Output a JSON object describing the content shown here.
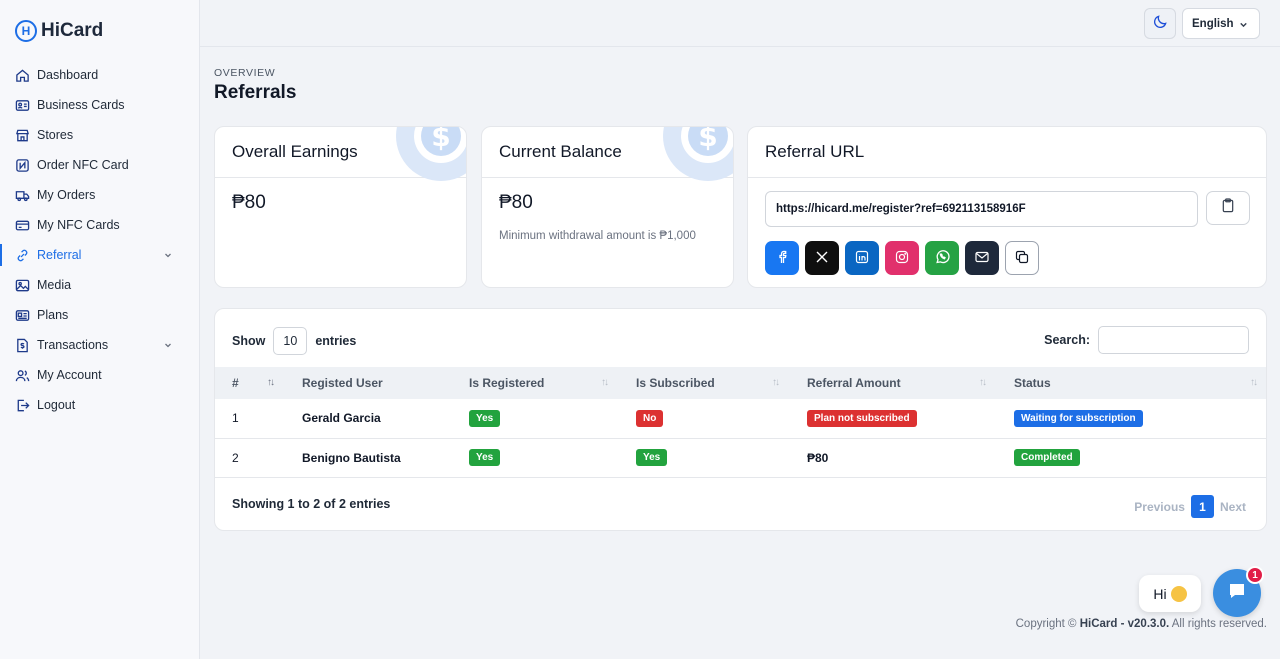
{
  "brand": {
    "name": "HiCard",
    "mark": "H"
  },
  "sidebar": {
    "items": [
      {
        "label": "Dashboard",
        "icon": "home-icon"
      },
      {
        "label": "Business Cards",
        "icon": "id-card-icon"
      },
      {
        "label": "Stores",
        "icon": "store-icon"
      },
      {
        "label": "Order NFC Card",
        "icon": "nfc-icon"
      },
      {
        "label": "My Orders",
        "icon": "truck-icon"
      },
      {
        "label": "My NFC Cards",
        "icon": "card-icon"
      },
      {
        "label": "Referral",
        "icon": "link-icon",
        "active": true,
        "expandable": true
      },
      {
        "label": "Media",
        "icon": "image-icon"
      },
      {
        "label": "Plans",
        "icon": "plans-icon"
      },
      {
        "label": "Transactions",
        "icon": "dollar-doc-icon",
        "expandable": true
      },
      {
        "label": "My Account",
        "icon": "users-icon"
      },
      {
        "label": "Logout",
        "icon": "logout-icon"
      }
    ]
  },
  "topbar": {
    "language": "English",
    "theme_icon": "moon-icon"
  },
  "header": {
    "overline": "OVERVIEW",
    "title": "Referrals"
  },
  "cards": {
    "earnings": {
      "title": "Overall Earnings",
      "amount": "₱80"
    },
    "balance": {
      "title": "Current Balance",
      "amount": "₱80",
      "note": "Minimum withdrawal amount is ₱1,000"
    },
    "referral": {
      "title": "Referral URL",
      "url": "https://hicard.me/register?ref=692113158916F",
      "share_buttons": [
        "facebook-icon",
        "x-icon",
        "linkedin-icon",
        "instagram-icon",
        "whatsapp-icon",
        "email-icon",
        "copy-icon"
      ]
    }
  },
  "table": {
    "show_label": "Show",
    "page_size": "10",
    "entries_label": "entries",
    "search_label": "Search:",
    "columns": [
      "#",
      "Registed User",
      "Is Registered",
      "Is Subscribed",
      "Referral Amount",
      "Status"
    ],
    "rows": [
      {
        "num": "1",
        "user": "Gerald Garcia",
        "registered": "Yes",
        "subscribed": "No",
        "amount": "Plan not subscribed",
        "status": "Waiting for subscription"
      },
      {
        "num": "2",
        "user": "Benigno Bautista",
        "registered": "Yes",
        "subscribed": "Yes",
        "amount": "₱80",
        "status": "Completed"
      }
    ],
    "info": "Showing 1 to 2 of 2 entries",
    "pager": {
      "previous": "Previous",
      "current": "1",
      "next": "Next"
    }
  },
  "chat": {
    "greeting": "Hi",
    "badge": "1"
  },
  "footer": {
    "prefix": "Copyright ©",
    "brand": "HiCard - v20.3.0.",
    "suffix": "All rights reserved."
  },
  "colors": {
    "accent": "#1d6ee6",
    "success": "#22a33e",
    "danger": "#dc3131"
  }
}
